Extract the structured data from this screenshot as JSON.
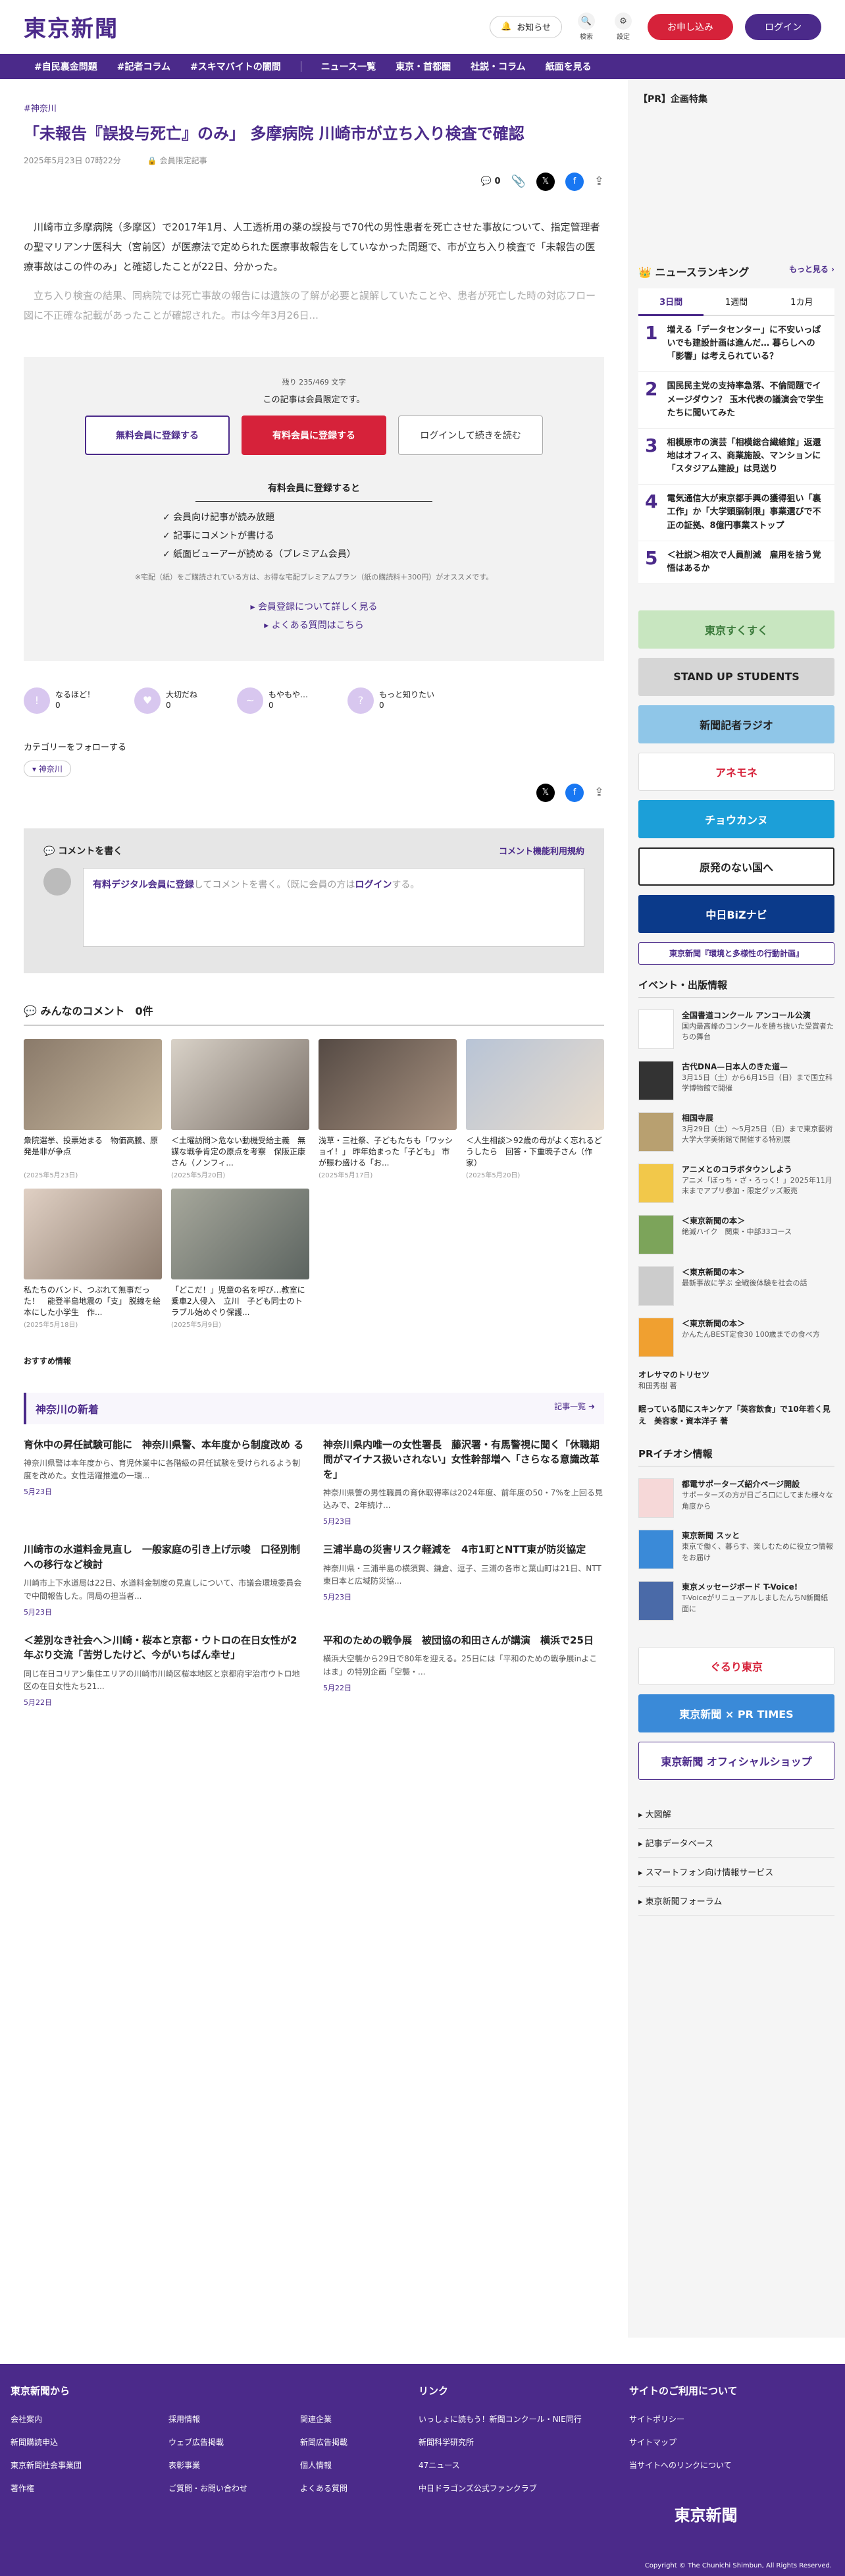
{
  "header": {
    "logo": "東京新聞",
    "notice": "お知らせ",
    "search": "検索",
    "settings": "設定",
    "apply": "お申し込み",
    "login": "ログイン"
  },
  "nav": [
    "#自民裏金問題",
    "#記者コラム",
    "#スキマバイトの闇間",
    "ニュース一覧",
    "東京・首都圏",
    "社説・コラム",
    "紙面を見る"
  ],
  "article": {
    "category": "#神奈川",
    "title": "「未報告『誤投与死亡』のみ」 多摩病院 川崎市が立ち入り検査で確認",
    "date": "2025年5月23日 07時22分",
    "members": "会員限定記事",
    "comments": "0",
    "p1": "川崎市立多摩病院（多摩区）で2017年1月、人工透析用の薬の誤投与で70代の男性患者を死亡させた事故について、指定管理者の聖マリアンナ医科大（宮前区）が医療法で定められた医療事故報告をしていなかった問題で、市が立ち入り検査で「未報告の医療事故はこの件のみ」と確認したことが22日、分かった。",
    "p2": "立ち入り検査の結果、同病院では死亡事故の報告には遺族の了解が必要と誤解していたことや、患者が死亡した時の対応フロー図に不正確な記載があったことが確認された。市は今年3月26日..."
  },
  "paywall": {
    "remain": "残り 235/469 文字",
    "msg": "この記事は会員限定です。",
    "free": "無料会員に登録する",
    "paid": "有料会員に登録する",
    "login": "ログインして続きを読む",
    "heading": "有料会員に登録すると",
    "benefits": [
      "✓ 会員向け記事が読み放題",
      "✓ 記事にコメントが書ける",
      "✓ 紙面ビューアーが読める（プレミアム会員）"
    ],
    "note": "※宅配（紙）をご購読されている方は、お得な宅配プレミアムプラン（紙の購読料＋300円）がオススメです。",
    "link1": "▸ 会員登録について詳しく見る",
    "link2": "▸ よくある質問はこちら"
  },
  "reactions": [
    {
      "label": "なるほど！",
      "count": "0"
    },
    {
      "label": "大切だね",
      "count": "0"
    },
    {
      "label": "もやもや…",
      "count": "0"
    },
    {
      "label": "もっと知りたい",
      "count": "0"
    }
  ],
  "follow": {
    "label": "カテゴリーをフォローする",
    "tag": "神奈川"
  },
  "comment": {
    "title": "コメントを書く",
    "rules": "コメント機能利用規約",
    "lead": "有料デジタル会員に登録",
    "rest": "してコメントを書く。（既に会員の方は",
    "login": "ログイン",
    "end": "する。",
    "all": "みんなのコメント　0件"
  },
  "cards": [
    {
      "t": "衆院選挙、投票始まる　物価高騰、原発是非が争点",
      "d": "(2025年5月23日)"
    },
    {
      "t": "＜土曜訪問＞危ない動機受給主義　無謀な戦争肯定の原点を考察　保阪正康さん（ノンフィ...",
      "d": "(2025年5月20日)"
    },
    {
      "t": "浅草・三社祭、子どもたちも「ワッショイ！」 昨年始まった「子ども」 市が賑わ盛ける「お...",
      "d": "(2025年5月17日)"
    },
    {
      "t": "＜人生相談＞92歳の母がよく忘れるどうしたら　回答・下重暁子さん（作家）",
      "d": "(2025年5月20日)"
    },
    {
      "t": "私たちのバンド、つぶれて無事だった！　能登半島地震の「支」 脱線を絵本にした小学生　作...",
      "d": "(2025年5月18日)"
    },
    {
      "t": "「どこだ！」児童の名を呼び…教室に乗車2人侵入　立川　子ども同士のトラブル始めぐり保護...",
      "d": "(2025年5月9日)"
    }
  ],
  "recommend": "おすすめ情報",
  "local": {
    "title": "神奈川の新着",
    "more": "記事一覧 ➜",
    "items": [
      {
        "t": "育休中の昇任試験可能に　神奈川県警、本年度から制度改め る",
        "e": "神奈川県警は本年度から、育児休業中に各階級の昇任試験を受けられるよう制度を改めた。女性活躍推進の一環...",
        "d": "5月23日"
      },
      {
        "t": "神奈川県内唯一の女性署長　藤沢署・有馬警視に聞く「休職期間がマイナス扱いされない」女性幹部増へ「さらなる意識改革を」",
        "e": "神奈川県警の男性職員の育休取得率は2024年度、前年度の50・7%を上回る見込みで、2年続け...",
        "d": "5月23日"
      },
      {
        "t": "川崎市の水道料金見直し　一般家庭の引き上げ示唆　口径別制への移行など検討",
        "e": "川崎市上下水道局は22日、水道料金制度の見直しについて、市議会環境委員会で中間報告した。同局の担当者...",
        "d": "5月23日"
      },
      {
        "t": "三浦半島の災害リスク軽減を　4市1町とNTT東が防災協定",
        "e": "神奈川県・三浦半島の横須賀、鎌倉、逗子、三浦の各市と葉山町は21日、NTT東日本と広域防災協...",
        "d": "5月23日"
      },
      {
        "t": "＜差別なき社会へ＞川崎・桜本と京都・ウトロの在日女性が2年ぶり交流「苦労したけど、今がいちばん幸せ」",
        "e": "同じ在日コリアン集住エリアの川崎市川崎区桜本地区と京都府宇治市ウトロ地区の在日女性たち21...",
        "d": "5月22日"
      },
      {
        "t": "平和のための戦争展　被団協の和田さんが講演　横浜で25日",
        "e": "横浜大空襲から29日で80年を迎える。25日には「平和のための戦争展inよこはま」の特別企画「空襲・...",
        "d": "5月22日"
      }
    ]
  },
  "side": {
    "pr": "【PR】企画特集",
    "ranking": "ニュースランキング",
    "more": "もっと見る ›",
    "tabs": [
      "3日間",
      "1週間",
      "1カ月"
    ],
    "items": [
      "増える「データセンター」に不安いっぱいでも建設計画は進んだ… 暮らしへの「影響」は考えられている？",
      "国民民主党の支持率急落、不倫問題でイメージダウン？ 玉木代表の議演会で学生たちに聞いてみた",
      "相模原市の演芸「相模総合繊維館」返還地はオフィス、商業施設、マンションに「スタジアム建設」は見送り",
      "電気通信大が東京都手興の獲得狙い「裏工作」か「大学頭脳制限」事業選びで不正の証拠、8億円事業ストップ",
      "＜社説＞相次で人員削減　雇用を捨う覚悟はあるか"
    ],
    "banners": [
      "東京すくすく",
      "STAND UP STUDENTS",
      "新聞記者ラジオ",
      "アネモネ",
      "チョウカンヌ",
      "原発のない国へ",
      "中日BiZナビ",
      "東京新聞『環境と多様性の行動計画』"
    ],
    "events_title": "イベント・出版情報",
    "events": [
      {
        "t": "全国書道コンクール アンコール公演",
        "s": "国内最高峰のコンクールを勝ち抜いた受賞者たちの舞台"
      },
      {
        "t": "古代DNA—日本人のきた道—",
        "s": "3月15日（土）から6月15日（日）まで国立科学博物館で開催"
      },
      {
        "t": "相国寺展",
        "s": "3月29日（土）〜5月25日（日）まで東京藝術大学大学美術館で開催する特別展"
      },
      {
        "t": "アニメとのコラボタウンしよう",
        "s": "アニメ「ぼっち・ざ・ろっく！」2025年11月末までアプリ参加・限定グッズ販売"
      },
      {
        "t": "＜東京新聞の本＞",
        "s": "絶滅ハイク　関東・中部33コース"
      },
      {
        "t": "＜東京新聞の本＞",
        "s": "最新事故に学ぶ 全戦後体験を社会の話"
      },
      {
        "t": "＜東京新聞の本＞",
        "s": "かんたんBEST定食30 100歳までの食べ方"
      },
      {
        "t": "オレサマのトリセツ",
        "s": "和田秀樹 著"
      },
      {
        "t": "眠っている間にスキンケア「英容飲食」で10年若く見え　美容家・資本洋子 著",
        "s": ""
      }
    ],
    "pr2_title": "PRイチオシ情報",
    "pr2": [
      {
        "t": "都電サポーターズ紹介ページ開設",
        "s": "サポーターズの方が日ごろ口にしてまた様々な角度から"
      },
      {
        "t": "東京新聞 スッと",
        "s": "東京で働く、暮らす、楽しむために役立つ情報をお届け"
      },
      {
        "t": "東京メッセージボード T-Voice!",
        "s": "T-VoiceがリニューアルしましたんちN新聞紙面に"
      }
    ],
    "banners2": [
      "ぐるり東京",
      "東京新聞 × PR TIMES",
      "東京新聞 オフィシャルショップ"
    ],
    "links": [
      "大図解",
      "記事データベース",
      "スマートフォン向け情報サービス",
      "東京新聞フォーラム"
    ]
  },
  "footer": {
    "c1": "東京新聞から",
    "c1a": [
      "会社案内",
      "新聞購読申込",
      "東京新聞社会事業団",
      "著作権"
    ],
    "c1b": [
      "採用情報",
      "ウェブ広告掲載",
      "表彰事業",
      "ご質問・お問い合わせ"
    ],
    "c1c": [
      "関連企業",
      "新聞広告掲載",
      "個人情報",
      "よくある質問"
    ],
    "c2": "リンク",
    "c2a": [
      "いっしょに読もう！新聞コンクール・NIE同行",
      "新聞科学研究所",
      "47ニュース",
      "中日ドラゴンズ公式ファンクラブ"
    ],
    "c3": "サイトのご利用について",
    "c3a": [
      "サイトポリシー",
      "サイトマップ",
      "当サイトへのリンクについて"
    ],
    "logo": "東京新聞",
    "copy": "Copyright © The Chunichi Shimbun, All Rights Reserved."
  }
}
